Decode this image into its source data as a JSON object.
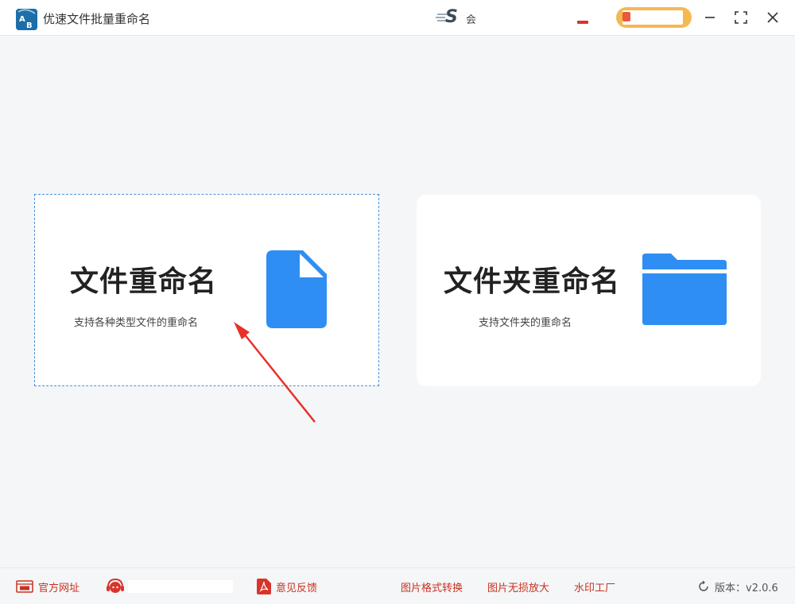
{
  "window": {
    "title": "优速文件批量重命名",
    "logo_letters": "AB",
    "brand_initial": "S",
    "brand_char": "会"
  },
  "cards": {
    "file": {
      "title": "文件重命名",
      "subtitle": "支持各种类型文件的重命名",
      "icon": "file-icon"
    },
    "folder": {
      "title": "文件夹重命名",
      "subtitle": "支持文件夹的重命名",
      "icon": "folder-icon"
    }
  },
  "statusbar": {
    "website": "官方网址",
    "feedback": "意见反馈",
    "img_convert": "图片格式转换",
    "img_enlarge": "图片无损放大",
    "watermark": "水印工厂",
    "version": "版本：v2.0.6"
  },
  "colors": {
    "accent_blue": "#2f8ef3",
    "link_red": "#c6321f",
    "vip_gold": "#f5b951",
    "arrow_red": "#e8312a"
  }
}
